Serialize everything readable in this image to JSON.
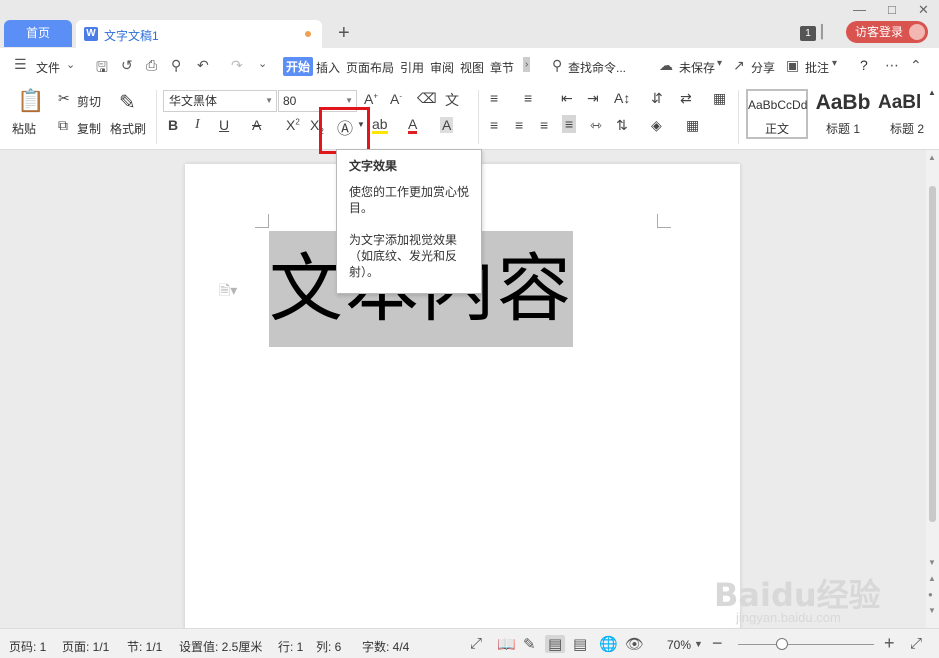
{
  "tabs": {
    "home": "首页",
    "doc": "文字文稿1",
    "add": "+"
  },
  "window": {
    "badge": "1",
    "login": "访客登录"
  },
  "menu": {
    "file": "文件",
    "start": "开始",
    "insert": "插入",
    "layout": "页面布局",
    "reference": "引用",
    "review": "审阅",
    "view": "视图",
    "chapter": "章节",
    "search": "查找命令...",
    "unsaved": "未保存",
    "share": "分享",
    "comment": "批注",
    "help": "?"
  },
  "ribbon": {
    "paste": "粘贴",
    "cut": "剪切",
    "copy": "复制",
    "format_painter": "格式刷",
    "font_name": "华文黑体",
    "font_size": "80",
    "styles": [
      {
        "sample": "AaBbCcDd",
        "name": "正文"
      },
      {
        "sample": "AaBb",
        "name": "标题 1"
      },
      {
        "sample": "AaBl",
        "name": "标题 2"
      }
    ]
  },
  "document": {
    "text": "文本内容"
  },
  "tooltip": {
    "title": "文字效果",
    "line1": "使您的工作更加赏心悦目。",
    "line2": "为文字添加视觉效果（如底纹、发光和反射）。"
  },
  "status": {
    "page": "页码: 1",
    "pages": "页面: 1/1",
    "section": "节: 1/1",
    "setting": "设置值: 2.5厘米",
    "row": "行: 1",
    "col": "列: 6",
    "words": "字数: 4/4",
    "zoom": "70%"
  },
  "watermark": {
    "brand": "Baidu经验",
    "url": "jingyan.baidu.com"
  }
}
